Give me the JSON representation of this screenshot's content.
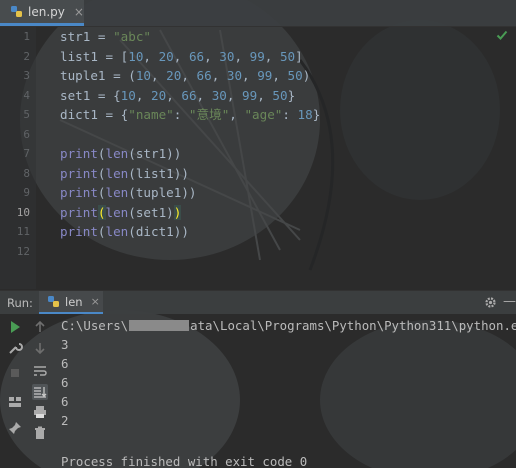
{
  "editor_tab": {
    "filename": "len.py",
    "close": "×"
  },
  "gutter": {
    "lines": [
      "1",
      "2",
      "3",
      "4",
      "5",
      "6",
      "7",
      "8",
      "9",
      "10",
      "11",
      "12"
    ],
    "active_line": "10"
  },
  "code": {
    "l1": {
      "var": "str1 = ",
      "str": "\"abc\""
    },
    "l2": {
      "var": "list1 = [",
      "n1": "10",
      "n2": "20",
      "n3": "66",
      "n4": "30",
      "n5": "99",
      "n6": "50",
      "close": "]"
    },
    "l3": {
      "var": "tuple1 = (",
      "n1": "10",
      "n2": "20",
      "n3": "66",
      "n4": "30",
      "n5": "99",
      "n6": "50",
      "close": ")"
    },
    "l4": {
      "var": "set1 = {",
      "n1": "10",
      "n2": "20",
      "n3": "66",
      "n4": "30",
      "n5": "99",
      "n6": "50",
      "close": "}"
    },
    "l5": {
      "var": "dict1 = {",
      "k1": "\"name\"",
      "v1": "\"意境\"",
      "k2": "\"age\"",
      "v2": "18",
      "close": "}"
    },
    "l7": {
      "fn": "print",
      "open": "(",
      "fn2": "len",
      "arg": "(str1))"
    },
    "l8": {
      "fn": "print",
      "open": "(",
      "fn2": "len",
      "arg": "(list1))"
    },
    "l9": {
      "fn": "print",
      "open": "(",
      "fn2": "len",
      "arg": "(tuple1))"
    },
    "l10": {
      "fn": "print",
      "open": "(",
      "fn2": "len",
      "arg": "(set1)",
      "close": ")"
    },
    "l11": {
      "fn": "print",
      "open": "(",
      "fn2": "len",
      "arg": "(dict1))"
    }
  },
  "run_panel": {
    "label": "Run:",
    "tab_name": "len",
    "tab_close": "×",
    "minimize": "—",
    "path_prefix": "C:\\Users\\",
    "path_suffix": "ata\\Local\\Programs\\Python\\Python311\\python.e",
    "outputs": [
      "3",
      "6",
      "6",
      "6",
      "2"
    ],
    "exit_message": "Process finished with exit code 0"
  },
  "colors": {
    "accent": "#4a88c7",
    "run_green": "#499c54",
    "string": "#6a8759",
    "number": "#6897bb",
    "builtin": "#8888c6"
  }
}
